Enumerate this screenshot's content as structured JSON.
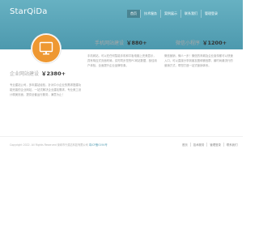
{
  "header": {
    "logo": "StarQiDa",
    "nav": [
      {
        "label": "首页",
        "active": true
      },
      {
        "label": "技术服务",
        "active": false
      },
      {
        "label": "案例展示",
        "active": false
      },
      {
        "label": "联系我们",
        "active": false
      },
      {
        "label": "管理登录",
        "active": false
      }
    ]
  },
  "products": [
    {
      "title": "企业网站建设",
      "price": "￥2380+",
      "desc": "专业建站公司，多年建站经验，针对中小企业的需求搭建功能完善的企业网站，一站式解决企业建站需求，专业美工设计精美页面，提供全套运行服务，满意为止！"
    },
    {
      "title": "手机网站建设",
      "price": "￥880+",
      "desc": "手机网站，可以在任何智能手机和平板电脑上完美显示，具有响应式页面布局，实时同步您的PC网站数据，极佳用户体验，全面提升企业品牌形象。"
    },
    {
      "title": "微信小程序",
      "price": "￥1200+",
      "desc": "微信营销，懂人一步！微信的商城及企业宣传都可以快速入口，可以直接分享到朋友圈和微信群，最时尚最流行的营销方式，帮您打造一站式营销体系。"
    }
  ],
  "footer": {
    "copyright": "Copyright 2022.  All Rights Reserved 深圳市兴源达科技有限公司",
    "icp": "粤ICP备0194号",
    "links": [
      "首页",
      "技术服务",
      "管理登录",
      "联系我们"
    ]
  },
  "colors": {
    "header": "#5aa5b9",
    "accent_circle": "#ee9832"
  }
}
